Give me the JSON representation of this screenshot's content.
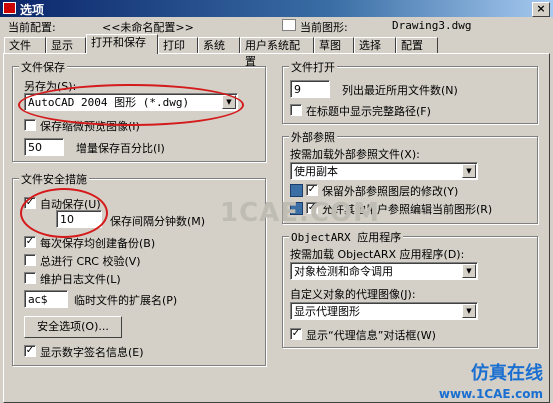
{
  "window": {
    "title": "选项",
    "close_label": "×"
  },
  "profile": {
    "current_profile_label": "当前配置:",
    "current_profile_value": "<<未命名配置>>",
    "current_drawing_label": "当前图形:",
    "current_drawing_value": "Drawing3.dwg"
  },
  "tabs": [
    {
      "label": "文件"
    },
    {
      "label": "显示"
    },
    {
      "label": "打开和保存"
    },
    {
      "label": "打印"
    },
    {
      "label": "系统"
    },
    {
      "label": "用户系统配置"
    },
    {
      "label": "草图"
    },
    {
      "label": "选择"
    },
    {
      "label": "配置"
    }
  ],
  "active_tab": "打开和保存",
  "file_save": {
    "group_label": "文件保存",
    "save_as_label": "另存为(S):",
    "save_as_value": "AutoCAD 2004 图形 (*.dwg)",
    "save_thumbnail_label": "保存缩微预览图像(I)",
    "save_thumbnail_checked": false,
    "incremental_value": "50",
    "incremental_label": "增量保存百分比(I)"
  },
  "file_safety": {
    "group_label": "文件安全措施",
    "autosave_label": "自动保存(U)",
    "autosave_checked": true,
    "interval_value": "10",
    "interval_label": "保存间隔分钟数(M)",
    "backup_label": "每次保存均创建备份(B)",
    "backup_checked": true,
    "crc_label": "总进行 CRC 校验(V)",
    "crc_checked": false,
    "log_label": "维护日志文件(L)",
    "log_checked": false,
    "temp_ext_value": "ac$",
    "temp_ext_label": "临时文件的扩展名(P)",
    "security_button": "安全选项(O)...",
    "digital_sig_label": "显示数字签名信息(E)",
    "digital_sig_checked": true
  },
  "file_open": {
    "group_label": "文件打开",
    "recent_value": "9",
    "recent_label": "列出最近所用文件数(N)",
    "full_path_label": "在标题中显示完整路径(F)",
    "full_path_checked": false
  },
  "xref": {
    "group_label": "外部参照",
    "demand_load_label": "按需加载外部参照文件(X):",
    "demand_load_value": "使用副本",
    "retain_changes_label": "保留外部参照图层的修改(Y)",
    "retain_changes_checked": true,
    "allow_edit_label": "允许其他用户参照编辑当前图形(R)",
    "allow_edit_checked": true
  },
  "objectarx": {
    "group_label": "ObjectARX 应用程序",
    "demand_load_label": "按需加载 ObjectARX 应用程序(D):",
    "demand_load_value": "对象检测和命令调用",
    "proxy_label": "自定义对象的代理图像(J):",
    "proxy_value": "显示代理图形",
    "proxy_dialog_label": "显示“代理信息”对话框(W)",
    "proxy_dialog_checked": true
  },
  "watermark": {
    "center_text": "1CAE.COM",
    "cn_text": "仿真在线",
    "site_text": "www.1CAE.com"
  },
  "annotation_color": "#d41a1a"
}
